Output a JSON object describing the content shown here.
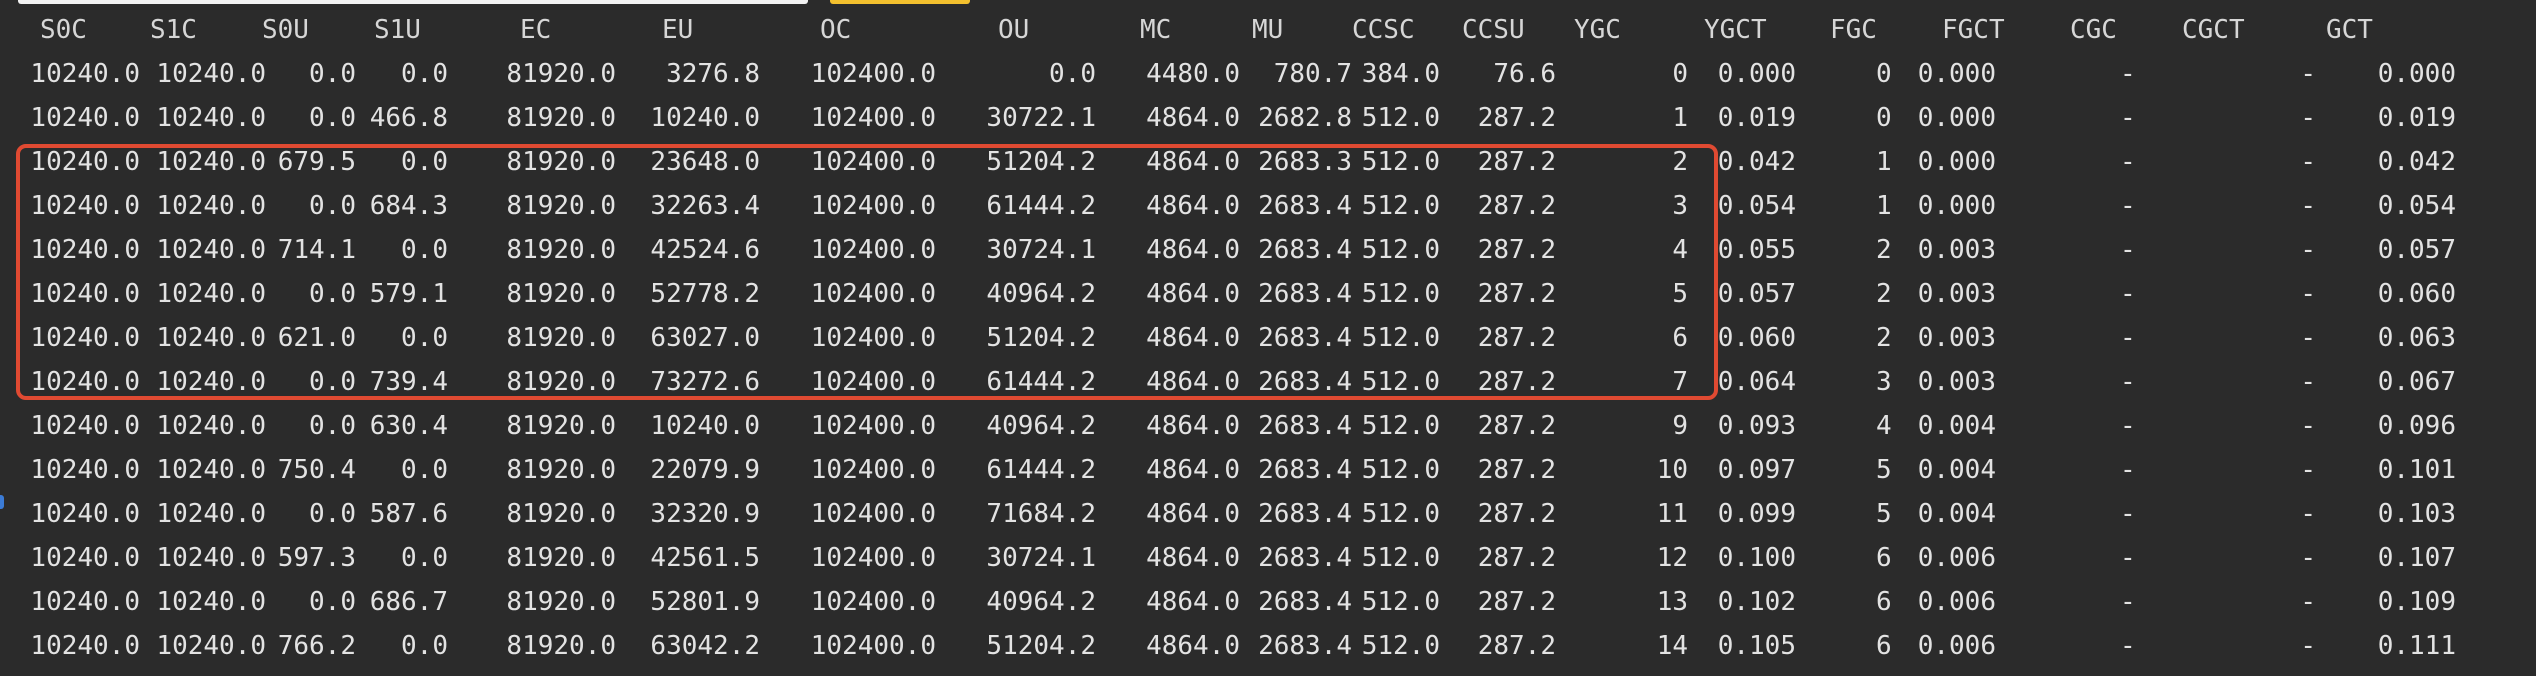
{
  "colors": {
    "background": "#2b2b2b",
    "text": "#e3e3e3",
    "highlight_border": "#e04a32",
    "tab_yellow": "#f3c02e",
    "side_marker": "#3b7bd6"
  },
  "columns": [
    "S0C",
    "S1C",
    "S0U",
    "S1U",
    "EC",
    "EU",
    "OC",
    "OU",
    "MC",
    "MU",
    "CCSC",
    "CCSU",
    "YGC",
    "YGCT",
    "FGC",
    "FGCT",
    "CGC",
    "CGCT",
    "GCT"
  ],
  "rows": [
    [
      "10240.0",
      "10240.0",
      "0.0",
      "0.0",
      "81920.0",
      "3276.8",
      "102400.0",
      "0.0",
      "4480.0",
      "780.7",
      "384.0",
      "76.6",
      "0",
      "0.000",
      "0",
      "0.000",
      "-",
      "-",
      "0.000"
    ],
    [
      "10240.0",
      "10240.0",
      "0.0",
      "466.8",
      "81920.0",
      "10240.0",
      "102400.0",
      "30722.1",
      "4864.0",
      "2682.8",
      "512.0",
      "287.2",
      "1",
      "0.019",
      "0",
      "0.000",
      "-",
      "-",
      "0.019"
    ],
    [
      "10240.0",
      "10240.0",
      "679.5",
      "0.0",
      "81920.0",
      "23648.0",
      "102400.0",
      "51204.2",
      "4864.0",
      "2683.3",
      "512.0",
      "287.2",
      "2",
      "0.042",
      "1",
      "0.000",
      "-",
      "-",
      "0.042"
    ],
    [
      "10240.0",
      "10240.0",
      "0.0",
      "684.3",
      "81920.0",
      "32263.4",
      "102400.0",
      "61444.2",
      "4864.0",
      "2683.4",
      "512.0",
      "287.2",
      "3",
      "0.054",
      "1",
      "0.000",
      "-",
      "-",
      "0.054"
    ],
    [
      "10240.0",
      "10240.0",
      "714.1",
      "0.0",
      "81920.0",
      "42524.6",
      "102400.0",
      "30724.1",
      "4864.0",
      "2683.4",
      "512.0",
      "287.2",
      "4",
      "0.055",
      "2",
      "0.003",
      "-",
      "-",
      "0.057"
    ],
    [
      "10240.0",
      "10240.0",
      "0.0",
      "579.1",
      "81920.0",
      "52778.2",
      "102400.0",
      "40964.2",
      "4864.0",
      "2683.4",
      "512.0",
      "287.2",
      "5",
      "0.057",
      "2",
      "0.003",
      "-",
      "-",
      "0.060"
    ],
    [
      "10240.0",
      "10240.0",
      "621.0",
      "0.0",
      "81920.0",
      "63027.0",
      "102400.0",
      "51204.2",
      "4864.0",
      "2683.4",
      "512.0",
      "287.2",
      "6",
      "0.060",
      "2",
      "0.003",
      "-",
      "-",
      "0.063"
    ],
    [
      "10240.0",
      "10240.0",
      "0.0",
      "739.4",
      "81920.0",
      "73272.6",
      "102400.0",
      "61444.2",
      "4864.0",
      "2683.4",
      "512.0",
      "287.2",
      "7",
      "0.064",
      "3",
      "0.003",
      "-",
      "-",
      "0.067"
    ],
    [
      "10240.0",
      "10240.0",
      "0.0",
      "630.4",
      "81920.0",
      "10240.0",
      "102400.0",
      "40964.2",
      "4864.0",
      "2683.4",
      "512.0",
      "287.2",
      "9",
      "0.093",
      "4",
      "0.004",
      "-",
      "-",
      "0.096"
    ],
    [
      "10240.0",
      "10240.0",
      "750.4",
      "0.0",
      "81920.0",
      "22079.9",
      "102400.0",
      "61444.2",
      "4864.0",
      "2683.4",
      "512.0",
      "287.2",
      "10",
      "0.097",
      "5",
      "0.004",
      "-",
      "-",
      "0.101"
    ],
    [
      "10240.0",
      "10240.0",
      "0.0",
      "587.6",
      "81920.0",
      "32320.9",
      "102400.0",
      "71684.2",
      "4864.0",
      "2683.4",
      "512.0",
      "287.2",
      "11",
      "0.099",
      "5",
      "0.004",
      "-",
      "-",
      "0.103"
    ],
    [
      "10240.0",
      "10240.0",
      "597.3",
      "0.0",
      "81920.0",
      "42561.5",
      "102400.0",
      "30724.1",
      "4864.0",
      "2683.4",
      "512.0",
      "287.2",
      "12",
      "0.100",
      "6",
      "0.006",
      "-",
      "-",
      "0.107"
    ],
    [
      "10240.0",
      "10240.0",
      "0.0",
      "686.7",
      "81920.0",
      "52801.9",
      "102400.0",
      "40964.2",
      "4864.0",
      "2683.4",
      "512.0",
      "287.2",
      "13",
      "0.102",
      "6",
      "0.006",
      "-",
      "-",
      "0.109"
    ],
    [
      "10240.0",
      "10240.0",
      "766.2",
      "0.0",
      "81920.0",
      "63042.2",
      "102400.0",
      "51204.2",
      "4864.0",
      "2683.4",
      "512.0",
      "287.2",
      "14",
      "0.105",
      "6",
      "0.006",
      "-",
      "-",
      "0.111"
    ]
  ]
}
